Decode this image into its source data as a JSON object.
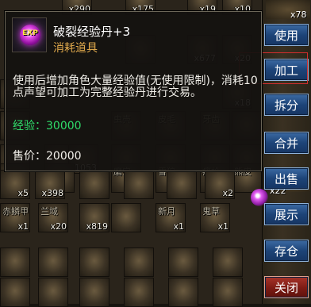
{
  "tooltip": {
    "icon_label": "EXP",
    "item_name": "破裂经验丹+3",
    "item_type": "消耗道具",
    "description": "使用后增加角色大量经验值(无使用限制)，消耗10点声望可加工为完整经验丹进行交易。",
    "exp_label": "经验：",
    "exp_value": "30000",
    "price_label": "售价：",
    "price_value": "20000"
  },
  "actions": {
    "use": "使用",
    "process": "加工",
    "split": "拆分",
    "merge": "合并",
    "sell": "出售",
    "display": "展示",
    "store": "存仓",
    "close": "关闭"
  },
  "grid_counts": {
    "row0": [
      "x290",
      "x175",
      "x19",
      "x10"
    ],
    "row1": [
      "x677",
      "x20"
    ],
    "row2": [
      "x18"
    ],
    "row6": [
      "x5",
      "x398",
      "x2"
    ],
    "row7": [
      "x1",
      "x20",
      "x819",
      "x1",
      "x1"
    ],
    "right": [
      "x78",
      "x22",
      "x1"
    ]
  },
  "grid_names": {
    "row3": [
      "虫壳",
      "皮毛",
      "牙齿"
    ],
    "row4": [
      "x1053"
    ],
    "row5": [
      "磨宝",
      "雪狼",
      "瘦枪",
      "熊皮"
    ],
    "row7": [
      "赤鳞甲",
      "兰域",
      "新月",
      "鬼草"
    ]
  }
}
